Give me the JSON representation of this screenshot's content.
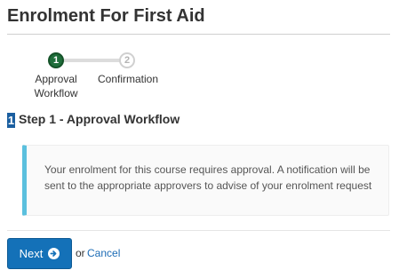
{
  "page": {
    "title": "Enrolment For First Aid"
  },
  "stepper": {
    "steps": [
      {
        "number": "1",
        "label": "Approval Workflow",
        "state": "active"
      },
      {
        "number": "2",
        "label": "Confirmation",
        "state": "inactive"
      }
    ],
    "active_color": "#1f6e3b"
  },
  "section": {
    "badge": "1",
    "heading": "Step 1 - Approval Workflow"
  },
  "info": {
    "message": "Your enrolment for this course requires approval. A notification will be sent to the appropriate approvers to advise of your enrolment request",
    "accent_color": "#5bc0de"
  },
  "actions": {
    "next_label": "Next",
    "next_icon": "arrow-circle-right-icon",
    "or_text": "or",
    "cancel_label": "Cancel",
    "primary_color": "#1471b8"
  }
}
